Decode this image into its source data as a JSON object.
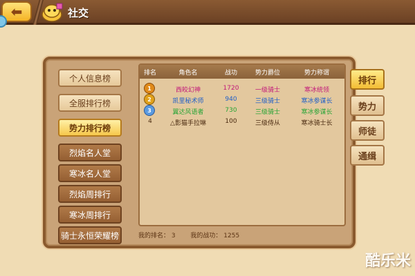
{
  "topbar": {
    "title": "社交",
    "back_icon": "back-arrow-icon",
    "social_icon": "social-emblem-icon"
  },
  "menu": {
    "items": [
      {
        "label": "个人信息榜",
        "style": "light"
      },
      {
        "label": "全服排行榜",
        "style": "light"
      },
      {
        "label": "势力排行榜",
        "style": "active"
      },
      {
        "label": "烈焰名人堂",
        "style": "dark"
      },
      {
        "label": "寒冰名人堂",
        "style": "dark"
      },
      {
        "label": "烈焰周排行",
        "style": "dark"
      },
      {
        "label": "寒冰周排行",
        "style": "dark"
      },
      {
        "label": "骑士永恒荣耀榜",
        "style": "dark"
      }
    ]
  },
  "table": {
    "headers": [
      "排名",
      "角色名",
      "战功",
      "势力爵位",
      "势力称谓"
    ],
    "rows": [
      {
        "rank": "1",
        "name": "西皎幻神",
        "score": "1720",
        "title": "一级骑士",
        "faction_title": "寒冰统领",
        "color": "#c2187a"
      },
      {
        "rank": "2",
        "name": "凯里秘术师",
        "score": "940",
        "title": "三级骑士",
        "faction_title": "寒冰参谋长",
        "color": "#1f5fc8"
      },
      {
        "rank": "3",
        "name": "翼达风语者",
        "score": "730",
        "title": "三级骑士",
        "faction_title": "寒冰参谋长",
        "color": "#27a436"
      },
      {
        "rank": "4",
        "name": "△影猫手拉琳",
        "score": "100",
        "title": "三级侍从",
        "faction_title": "寒冰骑士长",
        "color": "#4a2a10"
      }
    ]
  },
  "footer": {
    "my_rank_label": "我的排名：",
    "my_rank_value": "3",
    "my_score_label": "我的战功：",
    "my_score_value": "1255"
  },
  "tabs": [
    {
      "label": "排行",
      "active": true
    },
    {
      "label": "势力",
      "active": false
    },
    {
      "label": "师徒",
      "active": false
    },
    {
      "label": "通缉",
      "active": false
    }
  ],
  "watermark": "酷乐米"
}
